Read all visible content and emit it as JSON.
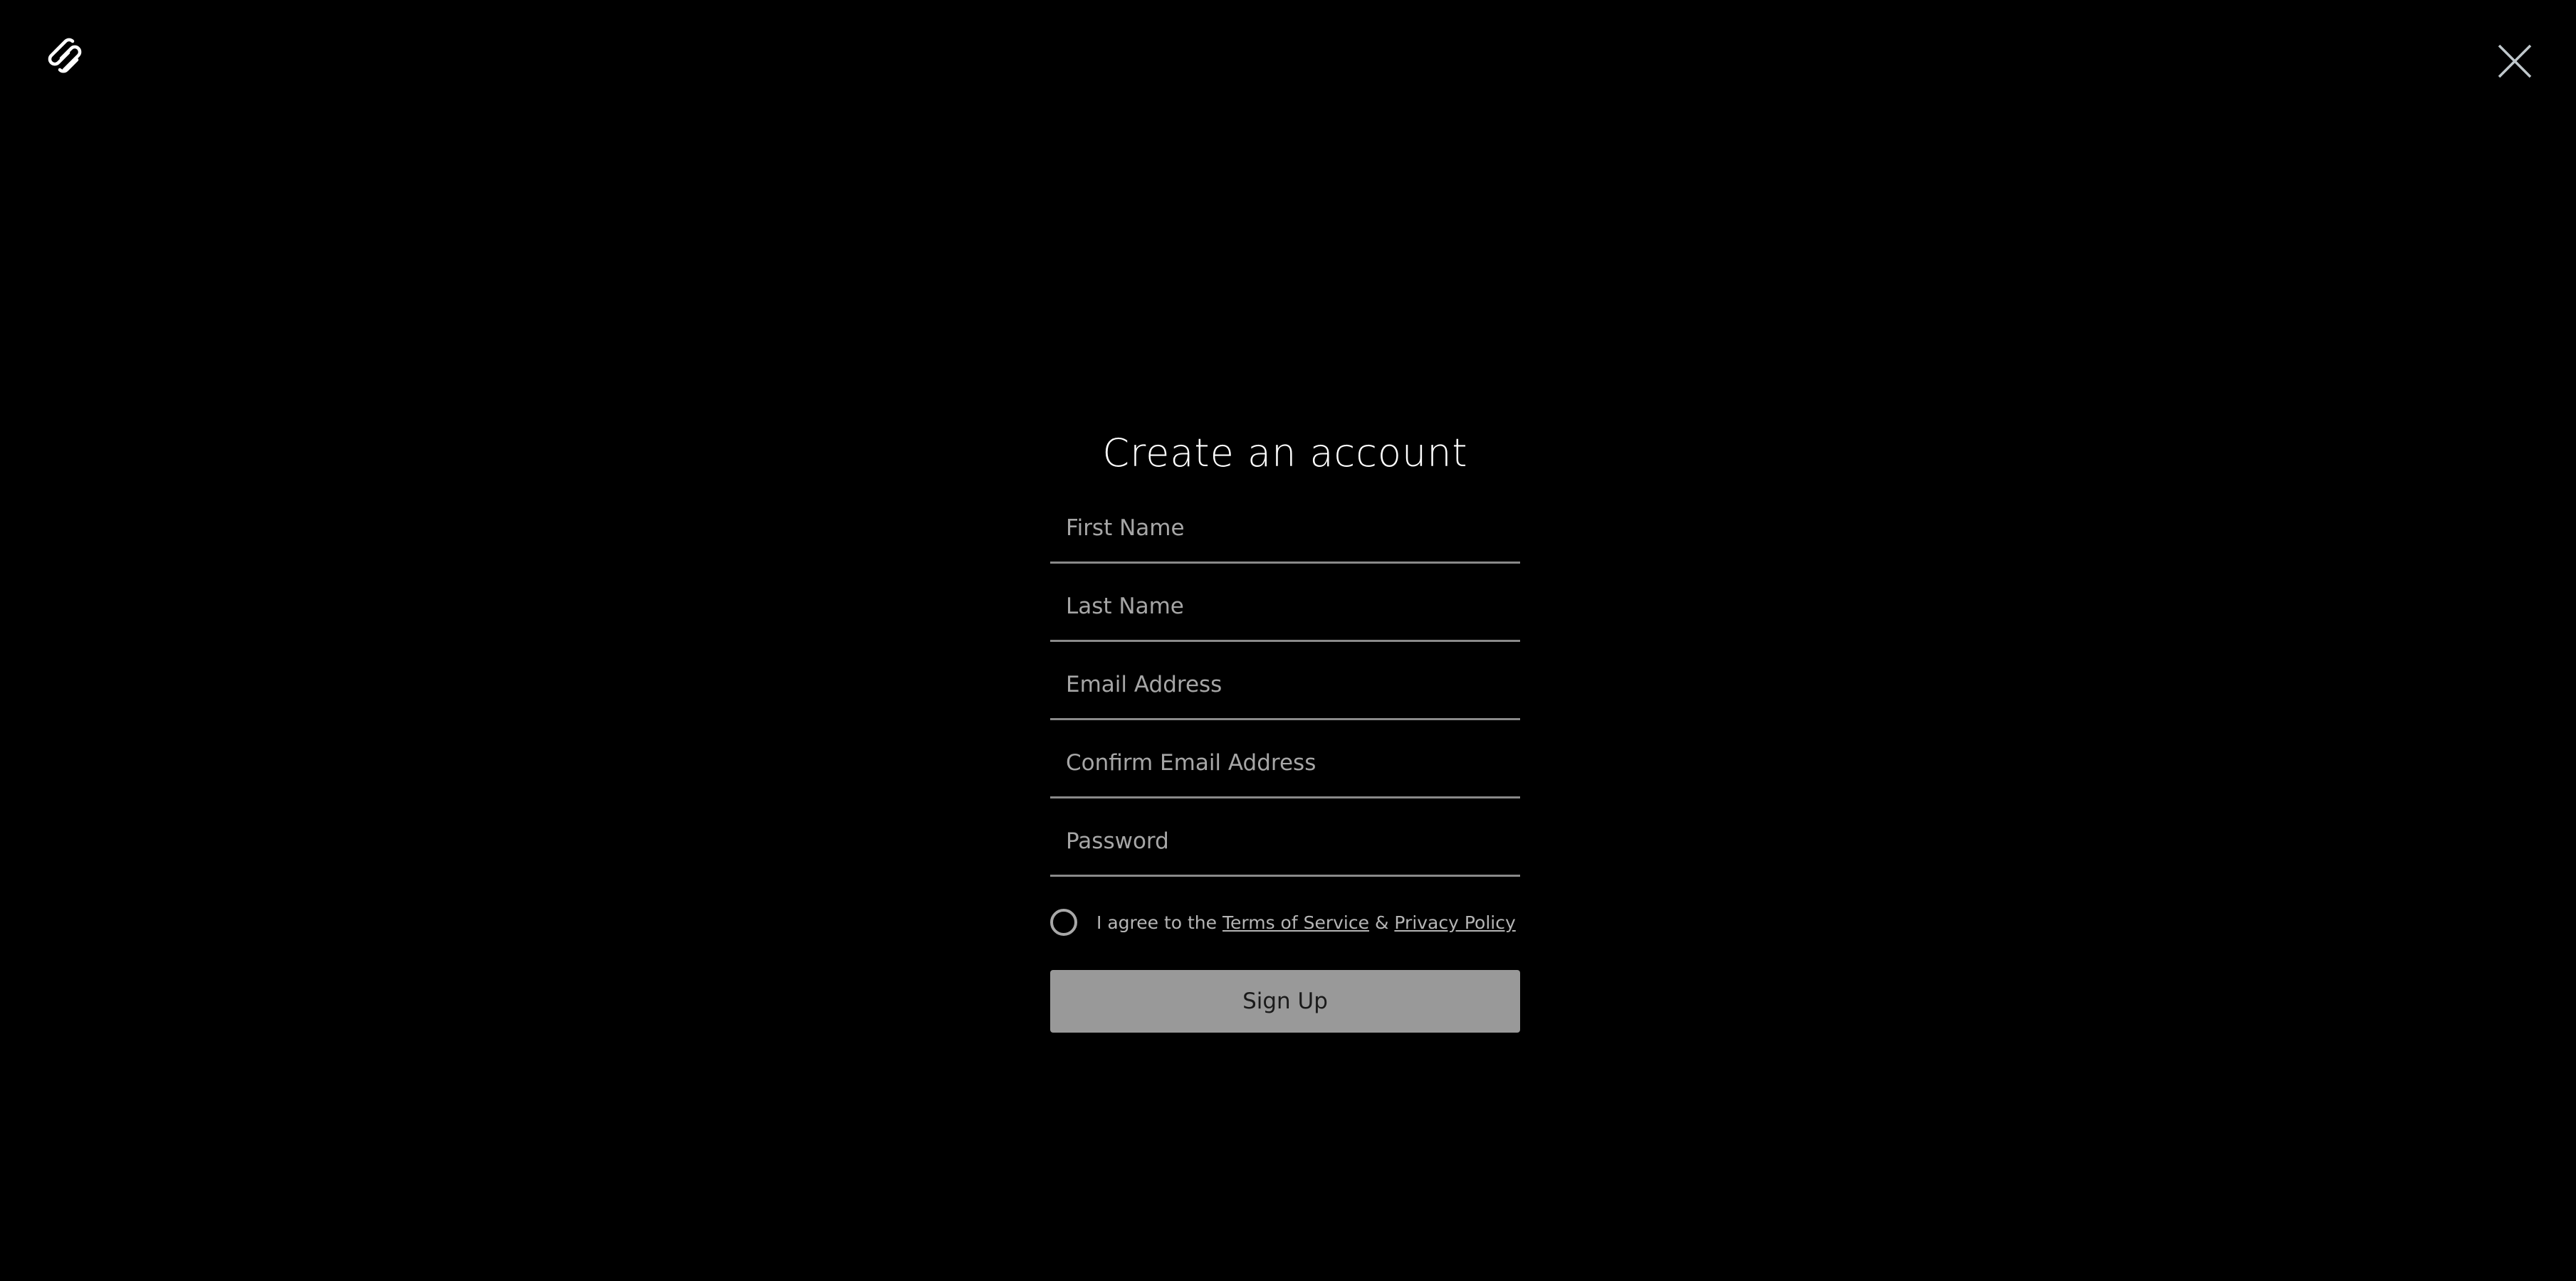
{
  "header": {
    "logo_icon": "squarespace-logo-icon",
    "close_icon": "close-icon"
  },
  "form": {
    "title": "Create an account",
    "fields": [
      {
        "name": "first-name",
        "placeholder": "First Name",
        "value": ""
      },
      {
        "name": "last-name",
        "placeholder": "Last Name",
        "value": ""
      },
      {
        "name": "email-address",
        "placeholder": "Email Address",
        "value": ""
      },
      {
        "name": "confirm-email-address",
        "placeholder": "Confirm Email Address",
        "value": ""
      },
      {
        "name": "password",
        "placeholder": "Password",
        "value": ""
      }
    ],
    "agreement": {
      "checked": false,
      "prefix": "I agree to the",
      "terms_label": "Terms of Service",
      "conjunction": "&",
      "privacy_label": "Privacy Policy"
    },
    "submit_label": "Sign Up"
  },
  "colors": {
    "background": "#000000",
    "placeholder": "#a6a6a6",
    "underline": "#8a8a8a",
    "button": "#999999",
    "button_text": "#1a1a1a"
  }
}
